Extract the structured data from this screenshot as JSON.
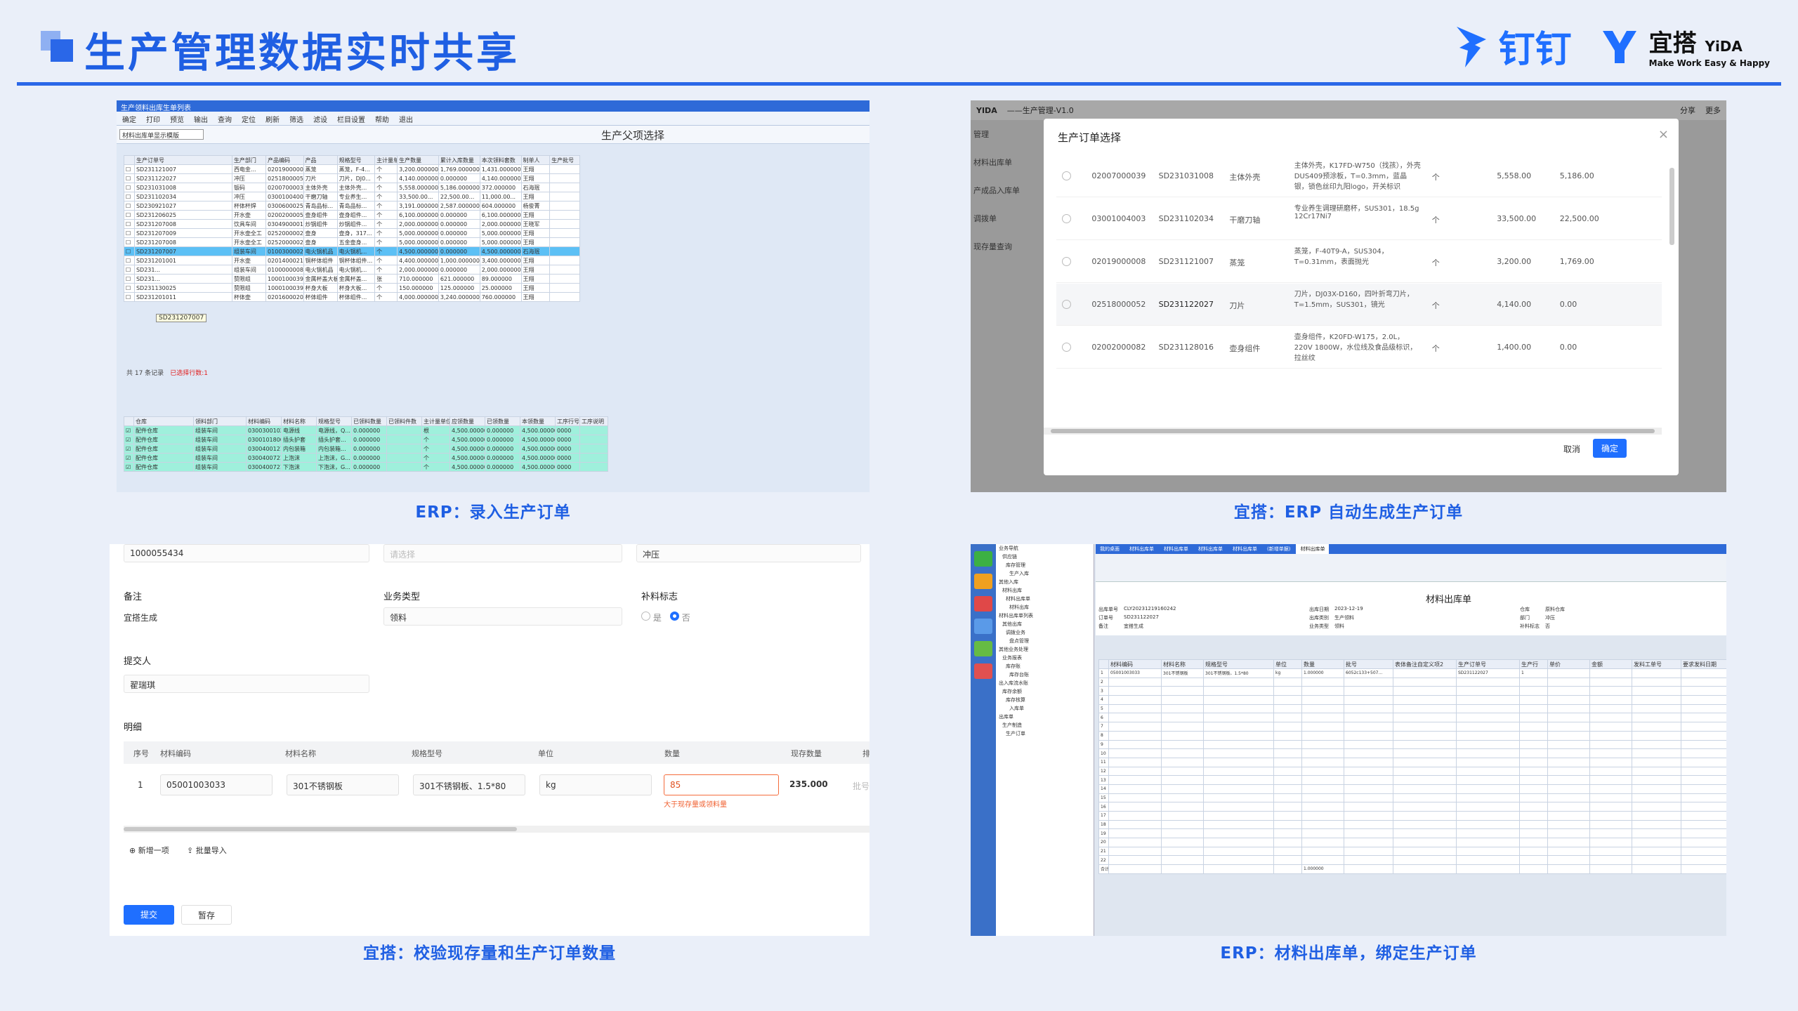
{
  "header": {
    "title": "生产管理数据实时共享",
    "dingtalk": "钉钉",
    "yida_cn": "宜搭",
    "yida_en": "YiDA",
    "yida_slogan": "Make Work Easy & Happy"
  },
  "captions": {
    "p1": "ERP：录入生产订单",
    "p2": "宜搭：ERP 自动生成生产订单",
    "p3": "宜搭：校验现存量和生产订单数量",
    "p4": "ERP：材料出库单，绑定生产订单"
  },
  "p1": {
    "window_title": "生产领料出库生单列表",
    "toolbar": [
      "确定",
      "打印",
      "预览",
      "输出",
      "查询",
      "定位",
      "刷新",
      "筛选",
      "滤设",
      "栏目设置",
      "帮助",
      "退出"
    ],
    "filter": "材料出库单显示模版",
    "title": "生产父项选择",
    "headers": [
      "",
      "生产订单号",
      "生产部门",
      "产品编码",
      "产品",
      "规格型号",
      "主计量单位",
      "生产数量",
      "累计入库数量",
      "本次领料套数",
      "制单人",
      "生产批号"
    ],
    "rows": [
      [
        "SD231121007",
        "西电金...",
        "02019000008",
        "蒸笼",
        "蒸笼，F-4...",
        "个",
        "3,200.000000",
        "1,769.000000",
        "1,431.000000",
        "王翔",
        ""
      ],
      [
        "SD231122027",
        "冲压",
        "02518000052",
        "刀片",
        "刀片，DJ0...",
        "个",
        "4,140.000000",
        "0.000000",
        "4,140.000000",
        "王翔",
        ""
      ],
      [
        "SD231031008",
        "钣码",
        "02007000039",
        "主体外壳",
        "主体外壳...",
        "个",
        "5,558.000000",
        "5,186.000000",
        "372.000000",
        "石海珉",
        ""
      ],
      [
        "SD231102034",
        "冲压",
        "03001004003",
        "干磨刀轴",
        "专业养生...",
        "个",
        "33,500.00...",
        "22,500.00...",
        "11,000.00...",
        "王翔",
        ""
      ],
      [
        "SD230921027",
        "杯体杯焊",
        "03006000250",
        "青岛品标...",
        "青岛品标...",
        "个",
        "3,191.000000",
        "2,587.000000",
        "604.000000",
        "杨俊菁",
        ""
      ],
      [
        "SD231206025",
        "开水壶",
        "02002000054",
        "壶身组件",
        "壶身组件...",
        "个",
        "6,100.000000",
        "0.000000",
        "6,100.000000",
        "王翔",
        ""
      ],
      [
        "SD231207008",
        "饮具车间",
        "03049000015",
        "炒锅组件",
        "炒锅组件...",
        "个",
        "2,000.000000",
        "0.000000",
        "2,000.000000",
        "王晓军",
        ""
      ],
      [
        "SD231207009",
        "开水壶全工",
        "02520000023",
        "壶身",
        "壶身，317...",
        "个",
        "5,000.000000",
        "0.000000",
        "5,000.000000",
        "王翔",
        ""
      ],
      [
        "SD231207008",
        "开水壶全工",
        "02520000023",
        "壶身",
        "五金壶身...",
        "个",
        "5,000.000000",
        "0.000000",
        "5,000.000000",
        "王翔",
        ""
      ],
      [
        "SD231207007",
        "组装车间",
        "01003000024",
        "电火锅机品",
        "电火锅机...",
        "个",
        "4,500.000000",
        "0.000000",
        "4,500.000000",
        "石海珉",
        ""
      ],
      [
        "SD231201001",
        "开水壶",
        "02014000218",
        "铜杯体组件",
        "铜杯体组件...",
        "个",
        "4,400.000000",
        "1,000.000000",
        "3,400.000000",
        "王翔",
        ""
      ],
      [
        "SD231...",
        "组装车间",
        "01000000089",
        "电火锅机品",
        "电火锅机...",
        "个",
        "2,000.000000",
        "0.000000",
        "2,000.000000",
        "王翔",
        ""
      ],
      [
        "SD231...",
        "赞限组",
        "10001000399",
        "金属杯盖大板",
        "金属杯盖...",
        "张",
        "710.000000",
        "621.000000",
        "89.000000",
        "王翔",
        ""
      ],
      [
        "SD231130025",
        "赞限组",
        "10001000394",
        "杯身大板",
        "杯身大板...",
        "个",
        "150.000000",
        "125.000000",
        "25.000000",
        "王翔",
        ""
      ],
      [
        "SD231201011",
        "杯体壶",
        "02016000206",
        "杯体组件",
        "杯体组件...",
        "个",
        "4,000.000000",
        "3,240.000000",
        "760.000000",
        "王翔",
        ""
      ]
    ],
    "tooltip": "SD231207007",
    "status": "共 17 条记录",
    "status_red": "已选择行数:1",
    "sub_headers": [
      "",
      "仓库",
      "领料部门",
      "材料编码",
      "材料名称",
      "规格型号",
      "已领料数量",
      "已领料件数",
      "主计量单位",
      "应领数量",
      "已领数量",
      "本领数量",
      "工序行号",
      "工序说明"
    ],
    "sub_rows": [
      [
        "配件仓库",
        "组装车间",
        "03003001021",
        "电源线",
        "电源线，Q...",
        "0.000000",
        "",
        "根",
        "4,500.000000",
        "0.000000",
        "4,500.000000",
        "0000",
        ""
      ],
      [
        "配件仓库",
        "组装车间",
        "03001018003",
        "插头护套",
        "插头护套...",
        "0.000000",
        "",
        "个",
        "4,500.000000",
        "0.000000",
        "4,500.000000",
        "0000",
        ""
      ],
      [
        "配件仓库",
        "组装车间",
        "03004001219",
        "内包装箱",
        "内包装箱...",
        "0.000000",
        "",
        "个",
        "4,500.000000",
        "0.000000",
        "4,500.000000",
        "0000",
        ""
      ],
      [
        "配件仓库",
        "组装车间",
        "03004007210",
        "上泡沫",
        "上泡沫，G...",
        "0.000000",
        "",
        "个",
        "4,500.000000",
        "0.000000",
        "4,500.000000",
        "0000",
        ""
      ],
      [
        "配件仓库",
        "组装车间",
        "03004007211",
        "下泡沫",
        "下泡沫，G...",
        "0.000000",
        "",
        "个",
        "4,500.000000",
        "0.000000",
        "4,500.000000",
        "0000",
        ""
      ]
    ]
  },
  "p2": {
    "app": "YIDA",
    "breadcrumb": "——生产管理-V1.0",
    "share": "分享",
    "more": "更多",
    "side": [
      "管理",
      "材料出库单",
      "产成品入库单",
      "调拨单",
      "现存量查询"
    ],
    "modal_title": "生产订单选择",
    "rows": [
      [
        "02007000039",
        "SD231031008",
        "主体外壳",
        "主体外壳，K17FD-W750（找孩），外壳 DUS409预涂板，T=0.3mm，蓝晶银，锁色丝印九阳logo，开关标识",
        "个",
        "5,558.00",
        "5,186.00"
      ],
      [
        "03001004003",
        "SD231102034",
        "干磨刀轴",
        "专业养生调理研磨杯，SUS301，18.5g 12Cr17Ni7",
        "个",
        "33,500.00",
        "22,500.00"
      ],
      [
        "02019000008",
        "SD231121007",
        "蒸笼",
        "蒸笼，F-40T9-A，SUS304，T=0.31mm，表面抛光",
        "个",
        "3,200.00",
        "1,769.00"
      ],
      [
        "02518000052",
        "SD231122027",
        "刀片",
        "刀片，DJ03X-D160，四叶折弯刀片，T=1.5mm，SUS301，镜光",
        "个",
        "4,140.00",
        "0.00"
      ],
      [
        "02002000082",
        "SD231128016",
        "壶身组件",
        "壶身组件，K20FD-W175，2.0L，220V 1800W，水位线及食品级标识，拉丝纹",
        "个",
        "1,400.00",
        "0.00"
      ]
    ],
    "cancel": "取消",
    "ok": "确定"
  },
  "p3": {
    "code_value": "1000055434",
    "select_ph": "请选择",
    "process": "冲压",
    "remark_label": "备注",
    "remark_value": "宜搭生成",
    "biz_label": "业务类型",
    "biz_value": "领料",
    "flag_label": "补料标志",
    "yes": "是",
    "no": "否",
    "submitter_label": "提交人",
    "submitter": "翟瑞琪",
    "detail_label": "明细",
    "cols": [
      "序号",
      "材料编码",
      "材料名称",
      "规格型号",
      "单位",
      "数量",
      "现存数量",
      "排"
    ],
    "row": {
      "no": "1",
      "code": "05001003033",
      "name": "301不锈钢板",
      "spec": "301不锈钢板、1.5*80",
      "unit": "kg",
      "qty": "85",
      "stock": "235.000",
      "extra": "批号"
    },
    "error": "大于现存量或领料量",
    "add": "新增一项",
    "batch": "批量导入",
    "submit": "提交",
    "save": "暂存"
  },
  "p4": {
    "tabs": [
      "我的桌面",
      "材料出库单",
      "材料出库单",
      "材料出库单",
      "材料出库单",
      "(新增单据)",
      "材料出库单"
    ],
    "title": "材料出库单",
    "tree": [
      "业务导航",
      "供应链",
      "库存管理",
      "生产入库",
      "其他入库",
      "材料出库",
      "材料出库单",
      "材料出库",
      "材料出库单列表",
      "其他出库",
      "调拨业务",
      "盘点管理",
      "其他业务处理",
      "业务报表",
      "库存账",
      "库存台账",
      "出入库流水账",
      "库存余额",
      "库存核算",
      "入库单",
      "出库单",
      "生产制造",
      "生产订单"
    ],
    "form": [
      "出库单号",
      "CLY20231219160242",
      "出库日期",
      "2023-12-19",
      "仓库",
      "原料仓库",
      "订单号",
      "SD231122027",
      "出库类别",
      "生产领料",
      "部门",
      "冲压",
      "备注",
      "宜搭生成",
      "业务类型",
      "领料",
      "补料标志",
      "否"
    ],
    "cols": [
      "",
      "材料编码",
      "材料名称",
      "规格型号",
      "单位",
      "数量",
      "批号",
      "表体备注自定义项2",
      "生产订单号",
      "生产行",
      "单价",
      "金额",
      "发料工单号",
      "要求发料日期"
    ],
    "row": [
      "1",
      "05001003033",
      "301不锈钢板",
      "301不锈钢板、1.5*80",
      "kg",
      "1.000000",
      "6052c133+507...",
      "",
      "SD231122027",
      "1",
      "",
      "",
      "",
      ""
    ],
    "total_label": "合计",
    "total": "1.000000"
  }
}
